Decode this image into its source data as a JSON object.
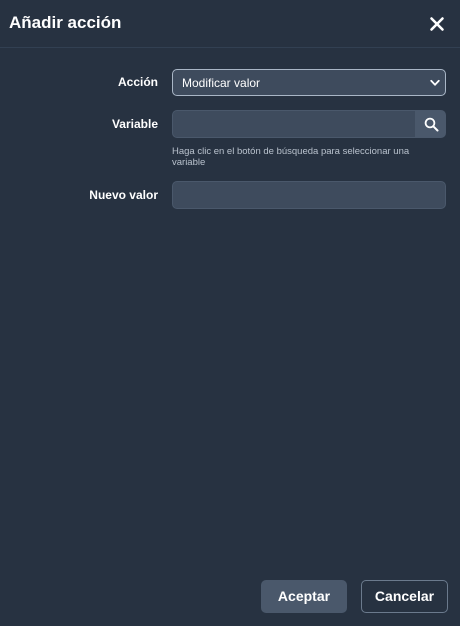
{
  "dialog": {
    "title": "Añadir acción",
    "close_icon": "close-icon"
  },
  "form": {
    "accion": {
      "label": "Acción",
      "selected": "Modificar valor",
      "icon": "chevron-down-icon"
    },
    "variable": {
      "label": "Variable",
      "value": "",
      "placeholder": "",
      "search_icon": "search-icon",
      "hint": "Haga clic en el botón de búsqueda para seleccionar una variable"
    },
    "nuevo_valor": {
      "label": "Nuevo valor",
      "value": "",
      "placeholder": ""
    }
  },
  "footer": {
    "accept_label": "Aceptar",
    "cancel_label": "Cancelar"
  },
  "colors": {
    "background": "#273241",
    "field": "#3e4b5d",
    "button": "#4a586b",
    "text": "#ffffff",
    "hint": "#b9c2cd"
  }
}
